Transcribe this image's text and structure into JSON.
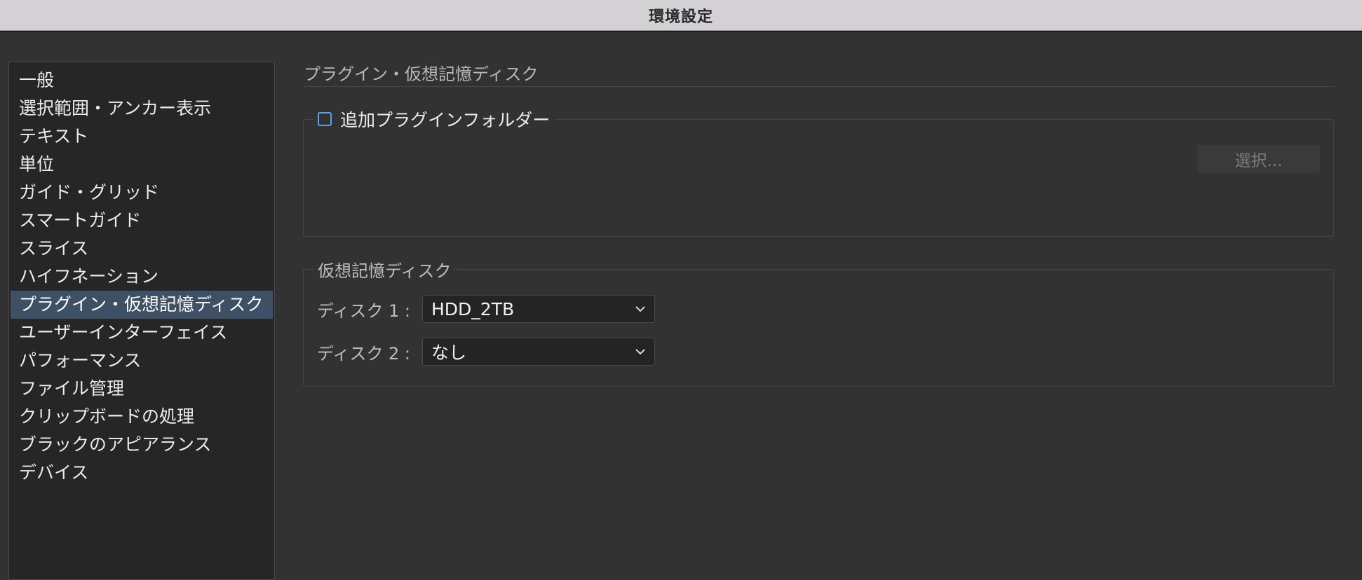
{
  "window": {
    "title": "環境設定"
  },
  "sidebar": {
    "items": [
      {
        "label": "一般"
      },
      {
        "label": "選択範囲・アンカー表示"
      },
      {
        "label": "テキスト"
      },
      {
        "label": "単位"
      },
      {
        "label": "ガイド・グリッド"
      },
      {
        "label": "スマートガイド"
      },
      {
        "label": "スライス"
      },
      {
        "label": "ハイフネーション"
      },
      {
        "label": "プラグイン・仮想記憶ディスク",
        "selected": true
      },
      {
        "label": "ユーザーインターフェイス"
      },
      {
        "label": "パフォーマンス"
      },
      {
        "label": "ファイル管理"
      },
      {
        "label": "クリップボードの処理"
      },
      {
        "label": "ブラックのアピアランス"
      },
      {
        "label": "デバイス"
      }
    ]
  },
  "main": {
    "section_title": "プラグイン・仮想記憶ディスク",
    "plugin_group": {
      "checkbox_label": "追加プラグインフォルダー",
      "checked": false,
      "choose_button": "選択..."
    },
    "scratch_group": {
      "title": "仮想記憶ディスク",
      "disks": [
        {
          "label": "ディスク 1 :",
          "value": "HDD_2TB"
        },
        {
          "label": "ディスク 2 :",
          "value": "なし"
        }
      ]
    }
  },
  "colors": {
    "selection": "#3d5066",
    "checkbox_border": "#5aa0e6",
    "background": "#323232"
  },
  "icons": {
    "dropdown": "chevron-down-icon",
    "checkbox": "checkbox-unchecked-icon"
  }
}
